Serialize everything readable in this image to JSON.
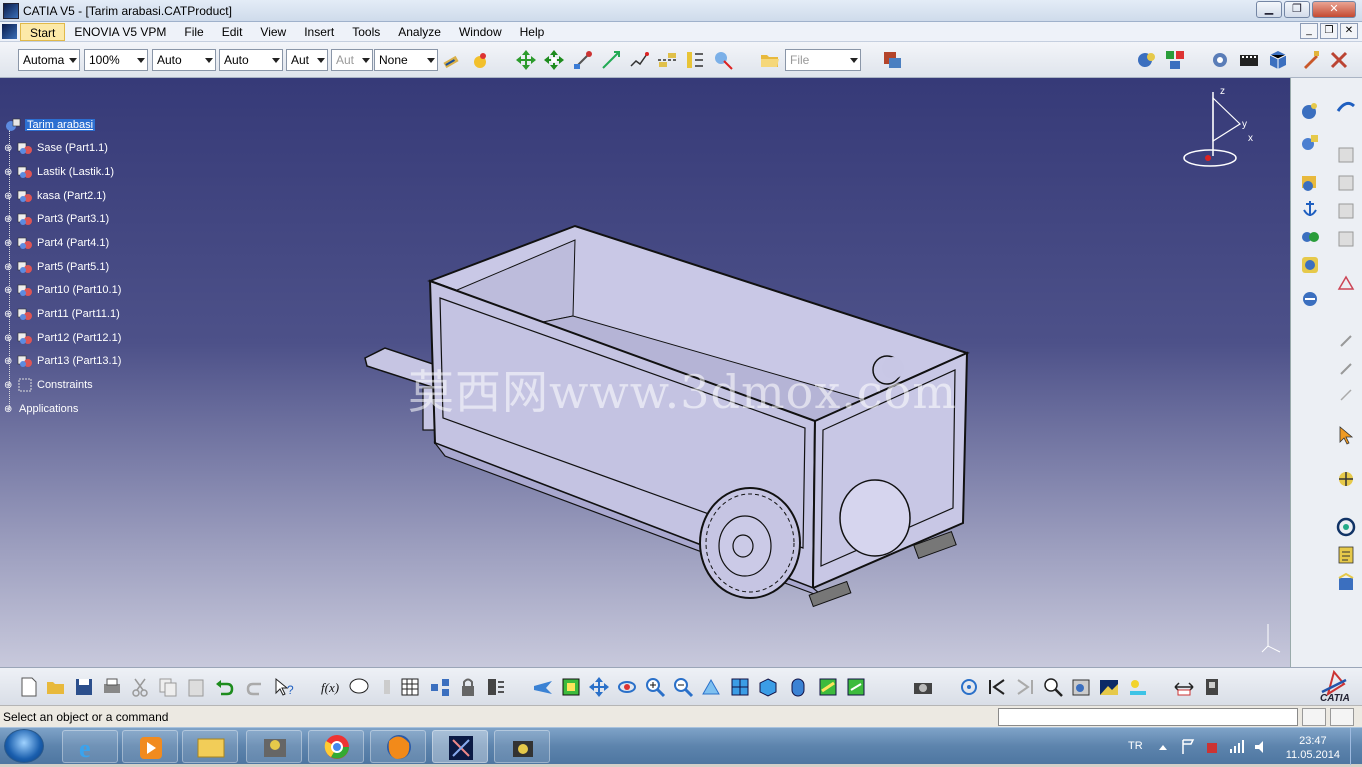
{
  "window": {
    "title": "CATIA V5 - [Tarim arabasi.CATProduct]",
    "minimize": "▁",
    "restore": "❐",
    "close": "✕"
  },
  "menu": {
    "items": [
      "Start",
      "ENOVIA V5 VPM",
      "File",
      "Edit",
      "View",
      "Insert",
      "Tools",
      "Analyze",
      "Window",
      "Help"
    ],
    "mdi_min": "_",
    "mdi_restore": "❐",
    "mdi_close": "✕"
  },
  "toolbar": {
    "combos": [
      "Automa",
      "100%",
      "Auto",
      "Auto",
      "Aut",
      "Aut",
      "None"
    ],
    "file_combo": "File"
  },
  "tree": {
    "items": [
      {
        "label": "Tarim arabasi"
      },
      {
        "label": "Sase (Part1.1)"
      },
      {
        "label": "Lastik (Lastik.1)"
      },
      {
        "label": "kasa (Part2.1)"
      },
      {
        "label": "Part3 (Part3.1)"
      },
      {
        "label": "Part4 (Part4.1)"
      },
      {
        "label": "Part5 (Part5.1)"
      },
      {
        "label": "Part10 (Part10.1)"
      },
      {
        "label": "Part11 (Part11.1)"
      },
      {
        "label": "Part12 (Part12.1)"
      },
      {
        "label": "Part13 (Part13.1)"
      },
      {
        "label": "Constraints"
      },
      {
        "label": "Applications"
      }
    ]
  },
  "viewport": {
    "watermark": "莫西网www.3dmox.com",
    "compass_axes": {
      "z": "z",
      "y": "y",
      "x": "x"
    }
  },
  "status": {
    "message": "Select an object or a command"
  },
  "taskbar": {
    "language": "TR",
    "time": "23:47",
    "date": "11.05.2014"
  },
  "brand": {
    "catia": "CATIA"
  },
  "colors": {
    "viewport_top": "#363a78",
    "viewport_bottom": "#c8c9dc",
    "selection": "#2c6fd1",
    "model_fill": "#c9c8e6"
  }
}
